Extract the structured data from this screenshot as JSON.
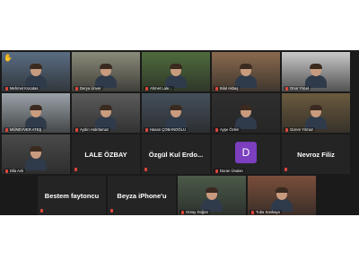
{
  "rows": [
    [
      {
        "name": "Mehmet Kocatas",
        "style": "video",
        "hand": true,
        "bg": "#5a6d83"
      },
      {
        "name": "Derya Ünver",
        "style": "video",
        "speaking": true,
        "bg": "#8b8b7a"
      },
      {
        "name": "Ahmet Lale...",
        "style": "video",
        "bg": "#4f6b3c"
      },
      {
        "name": "Bilal Akbaş",
        "style": "video",
        "bg": "#8a6a4e"
      },
      {
        "name": "Onur Yücel",
        "style": "video",
        "bg": "#c9c9c9"
      }
    ],
    [
      {
        "name": "MÜNEVVER ATEŞ",
        "style": "video",
        "bg": "#9aa2a8"
      },
      {
        "name": "Aydın Hıdırlamaz",
        "style": "video",
        "bg": "#5b5b5b"
      },
      {
        "name": "Hasan ÇOBANOĞLU",
        "style": "video",
        "bg": "#45505a"
      },
      {
        "name": "Ayşe Özlen",
        "style": "video",
        "bg": "#2f2f2f"
      },
      {
        "name": "Gizem Yılmaz",
        "style": "video",
        "bg": "#6b5a3e"
      }
    ],
    [
      {
        "name": "Dila Avlı",
        "style": "video",
        "bg": "#4a4a4a"
      },
      {
        "name": "LALE ÖZBAY",
        "style": "name"
      },
      {
        "name": "Özgül Kul Erdo...",
        "style": "name"
      },
      {
        "name": "Duran Ünalan",
        "style": "avatar",
        "letter": "D"
      },
      {
        "name": "Nevroz Filiz",
        "style": "name"
      }
    ],
    [
      {
        "name": "Bestem faytoncu",
        "style": "name"
      },
      {
        "name": "Beyza iPhone'u",
        "style": "name"
      },
      {
        "name": "Güray Doğan",
        "style": "video",
        "bg": "#4b5a49"
      },
      {
        "name": "Tuba Sankaya",
        "style": "video",
        "bg": "#7a4e3a"
      }
    ]
  ],
  "icons": {
    "raised_hand": "hand-icon",
    "muted": "mic-off-icon"
  },
  "colors": {
    "speaking": "#d7c23a",
    "muted": "#e0463c",
    "avatar": "#7b3fbf"
  }
}
